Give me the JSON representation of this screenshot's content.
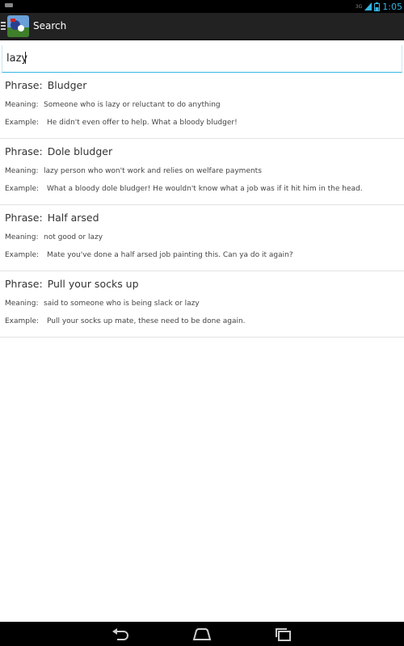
{
  "status_bar": {
    "time": "1:05",
    "network": "3G"
  },
  "action_bar": {
    "title": "Search"
  },
  "search": {
    "value": "lazy"
  },
  "labels": {
    "phrase": "Phrase:",
    "meaning": "Meaning:",
    "example": "Example:"
  },
  "results": [
    {
      "phrase": "Bludger",
      "meaning": "Someone who is lazy or reluctant to do anything",
      "example": "He didn't even offer to help. What a bloody bludger!"
    },
    {
      "phrase": "Dole bludger",
      "meaning": "lazy person who won't work and relies on welfare payments",
      "example": "What a bloody dole bludger! He wouldn't know what a job was if it hit him in the head."
    },
    {
      "phrase": "Half arsed",
      "meaning": "not good or lazy",
      "example": "Mate you've done a half arsed job painting this. Can ya do it again?"
    },
    {
      "phrase": "Pull your socks up",
      "meaning": "said to someone who is being slack or lazy",
      "example": "Pull your socks up mate, these need to be done again."
    }
  ]
}
